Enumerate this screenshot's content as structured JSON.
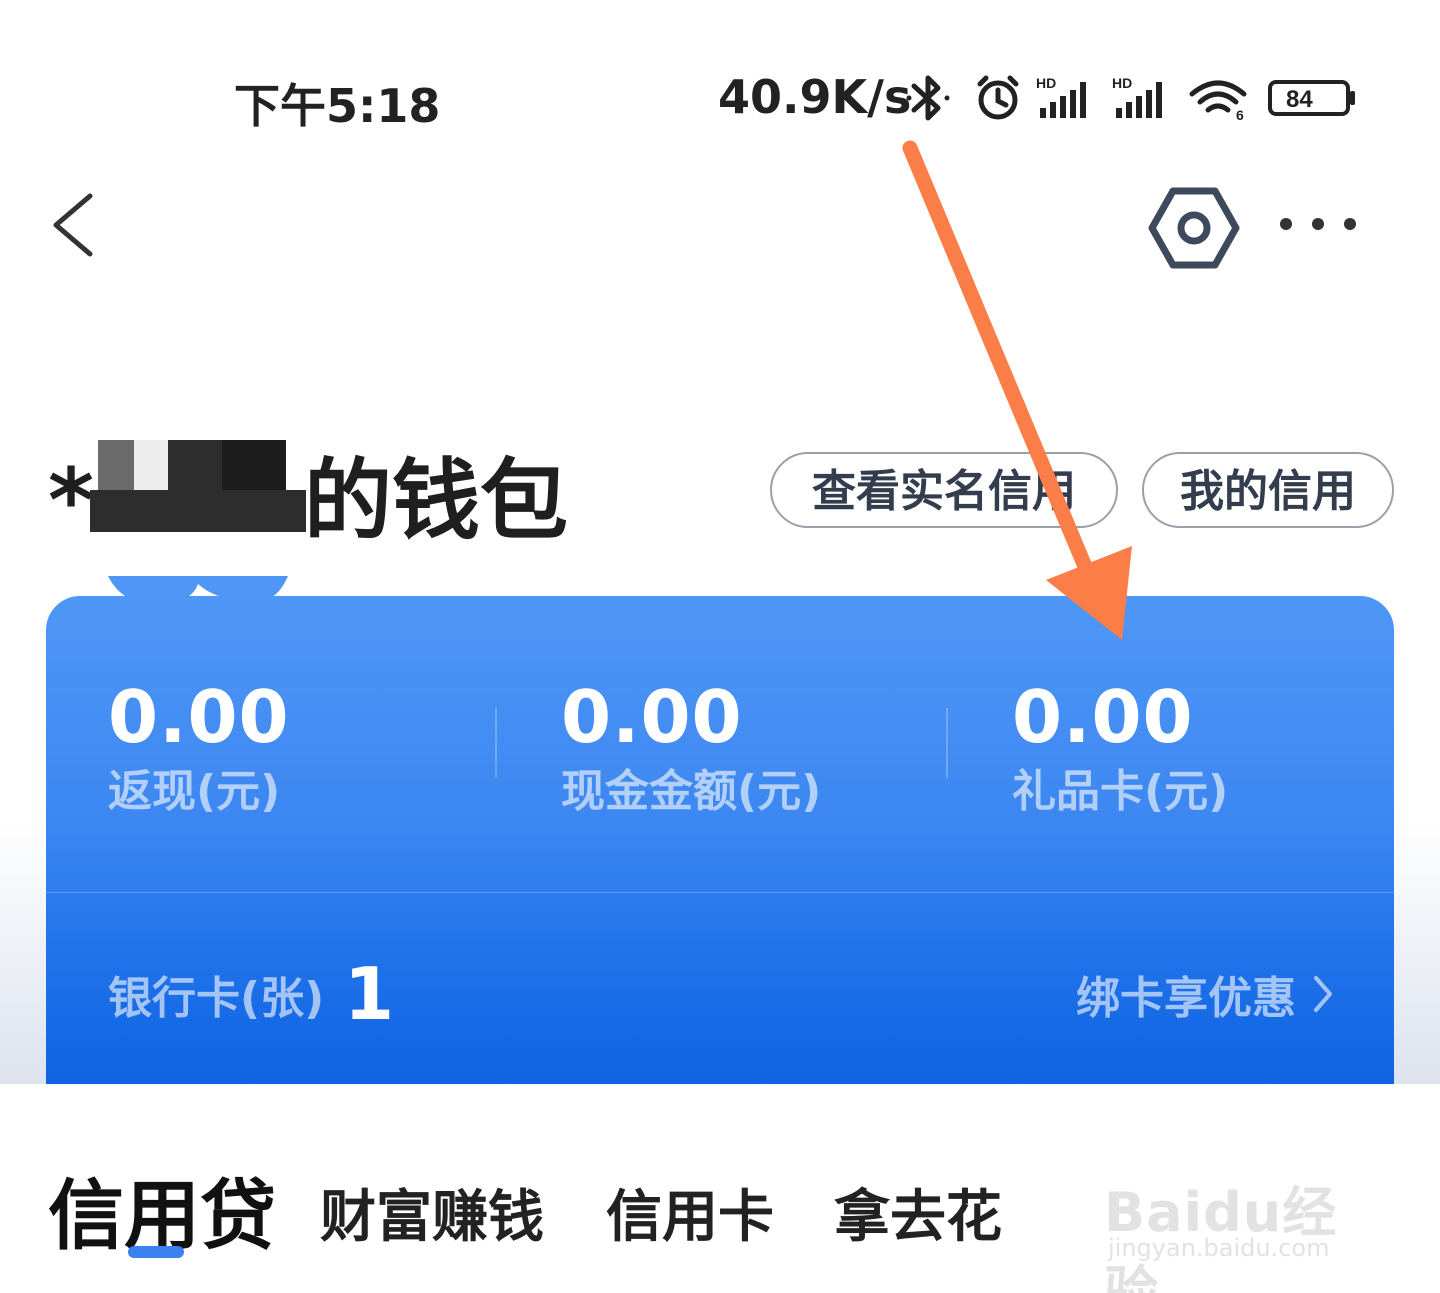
{
  "status_bar": {
    "time": "下午5:18",
    "network_speed": "40.9K/s",
    "battery": "84"
  },
  "header": {
    "title_suffix": "的钱包",
    "title_masked_prefix": "*",
    "buttons": {
      "realname_credit": "查看实名信用",
      "my_credit": "我的信用"
    }
  },
  "wallet": {
    "stats": [
      {
        "value": "0.00",
        "label": "返现(元)"
      },
      {
        "value": "0.00",
        "label": "现金金额(元)"
      },
      {
        "value": "0.00",
        "label": "礼品卡(元)"
      }
    ],
    "bank_cards": {
      "label": "银行卡(张)",
      "count": "1"
    },
    "bind_link": "绑卡享优惠"
  },
  "tabs": [
    {
      "label": "信用贷",
      "active": true
    },
    {
      "label": "财富赚钱",
      "active": false
    },
    {
      "label": "信用卡",
      "active": false
    },
    {
      "label": "拿去花",
      "active": false
    }
  ],
  "watermark": {
    "brand": "Baidu经验",
    "url": "jingyan.baidu.com"
  },
  "colors": {
    "card_top": "#4f97f6",
    "card_bottom": "#0f63e2",
    "tab_indicator": "#3b82f0",
    "annotation_arrow": "#fb7d47"
  },
  "icons": [
    "back-icon",
    "settings-icon",
    "more-icon",
    "bluetooth-icon",
    "alarm-icon",
    "signal-icon",
    "wifi-icon",
    "battery-icon",
    "chevron-right-icon"
  ]
}
